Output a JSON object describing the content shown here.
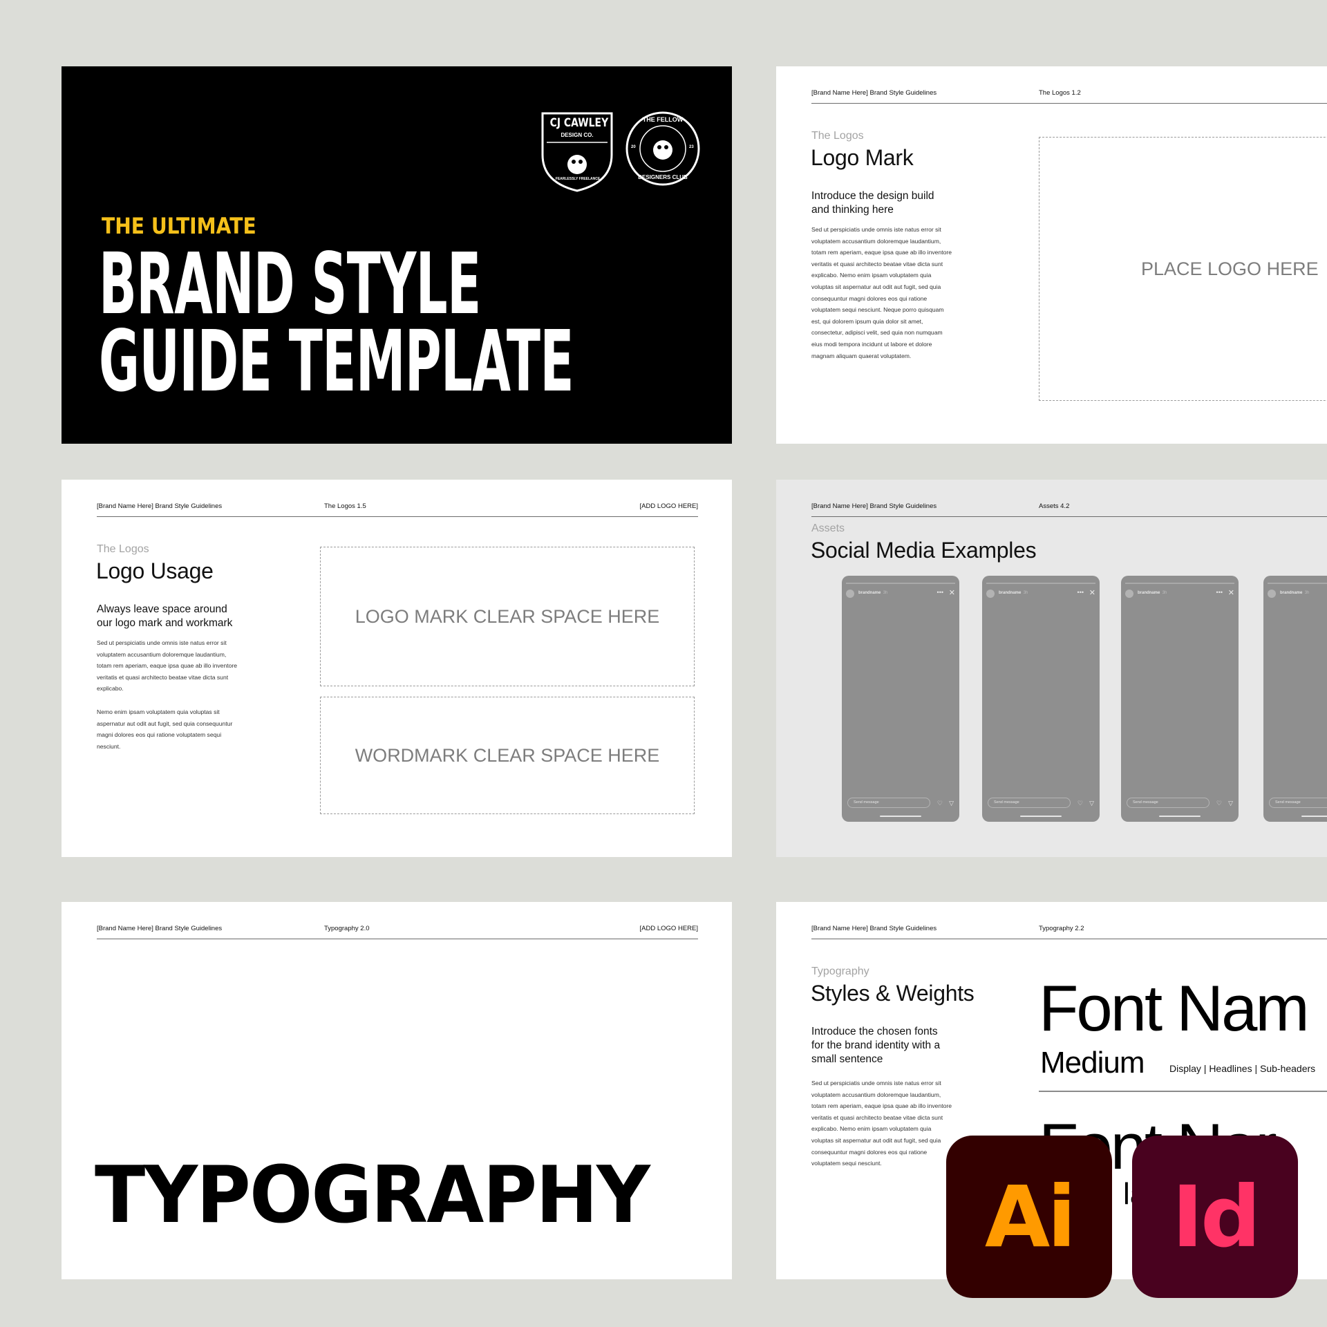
{
  "cover": {
    "badge1_line1": "CJ CAWLEY",
    "badge1_line2": "DESIGN CO.",
    "badge1_arc": "FEARLESSLY FREELANCE",
    "badge2_arc_top": "THE FELLOW",
    "badge2_arc_bottom": "DESIGNERS CLUB",
    "badge2_year_left": "20",
    "badge2_year_right": "23",
    "subtitle": "THE ULTIMATE",
    "title_line1": "BRAND STYLE",
    "title_line2": "GUIDE TEMPLATE",
    "accent_color": "#f5c01a"
  },
  "logo_mark": {
    "header_left": "[Brand Name Here] Brand Style Guidelines",
    "header_mid": "The Logos 1.2",
    "eyebrow": "The Logos",
    "title": "Logo Mark",
    "intro_line1": "Introduce the design build",
    "intro_line2": "and thinking here",
    "body_lines": [
      "Sed ut perspiciatis unde omnis iste natus error sit",
      "voluptatem accusantium doloremque laudantium,",
      "totam rem aperiam, eaque ipsa quae ab illo inventore",
      "veritatis et quasi architecto beatae vitae dicta sunt",
      "explicabo. Nemo enim ipsam voluptatem quia",
      "voluptas sit aspernatur aut odit aut fugit, sed quia",
      "consequuntur magni dolores eos qui ratione",
      "voluptatem sequi nesciunt. Neque porro quisquam",
      "est, qui dolorem ipsum quia dolor sit amet,",
      "consectetur, adipisci velit, sed quia non numquam",
      "eius modi tempora incidunt ut labore et dolore",
      "magnam aliquam quaerat voluptatem."
    ],
    "placeholder": "PLACE LOGO HERE"
  },
  "logo_usage": {
    "header_left": "[Brand Name Here] Brand Style Guidelines",
    "header_mid": "The Logos 1.5",
    "header_right": "[ADD LOGO HERE]",
    "eyebrow": "The Logos",
    "title": "Logo Usage",
    "intro_line1": "Always leave space around",
    "intro_line2": "our logo mark and workmark",
    "body_p1": [
      "Sed ut perspiciatis unde omnis iste natus error sit",
      "voluptatem accusantium doloremque laudantium,",
      "totam rem aperiam, eaque ipsa quae ab illo inventore",
      "veritatis et quasi architecto beatae vitae dicta sunt",
      "explicabo."
    ],
    "body_p2": [
      "Nemo enim ipsam voluptatem quia voluptas sit",
      "aspernatur aut odit aut fugit, sed quia consequuntur",
      "magni dolores eos qui ratione voluptatem sequi",
      "nesciunt."
    ],
    "placeholder1": "LOGO MARK CLEAR SPACE HERE",
    "placeholder2": "WORDMARK CLEAR SPACE HERE"
  },
  "social": {
    "header_left": "[Brand Name Here] Brand Style Guidelines",
    "header_mid": "Assets 4.2",
    "eyebrow": "Assets",
    "title": "Social Media Examples",
    "phone_username": "brandname",
    "phone_time": "3h",
    "phone_message": "Send message",
    "phone_count": 4
  },
  "typography": {
    "header_left": "[Brand Name Here] Brand Style Guidelines",
    "header_mid": "Typography 2.0",
    "header_right": "[ADD LOGO HERE]",
    "big_title": "TYPOGRAPHY"
  },
  "styles": {
    "header_left": "[Brand Name Here] Brand Style Guidelines",
    "header_mid": "Typography 2.2",
    "eyebrow": "Typography",
    "title": "Styles & Weights",
    "intro_lines": [
      "Introduce the chosen fonts",
      "for the brand identity with a",
      "small sentence"
    ],
    "body_lines": [
      "Sed ut perspiciatis unde omnis iste natus error sit",
      "voluptatem accusantium doloremque laudantium,",
      "totam rem aperiam, eaque ipsa quae ab illo inventore",
      "veritatis et quasi architecto beatae vitae dicta sunt",
      "explicabo. Nemo enim ipsam voluptatem quia",
      "voluptas sit aspernatur aut odit aut fugit, sed quia",
      "consequuntur magni dolores eos qui ratione",
      "voluptatem sequi nesciunt."
    ],
    "font_name_1": "Font Nam",
    "weight_1": "Medium",
    "usage_1": "Display | Headlines | Sub-headers",
    "font_name_2": "Font Nar",
    "weight_2_partial": "la"
  },
  "apps": {
    "illustrator_label": "Ai",
    "illustrator_bg": "#330000",
    "illustrator_fg": "#ff9a00",
    "indesign_label": "Id",
    "indesign_bg": "#49021f",
    "indesign_fg": "#ff3366"
  }
}
